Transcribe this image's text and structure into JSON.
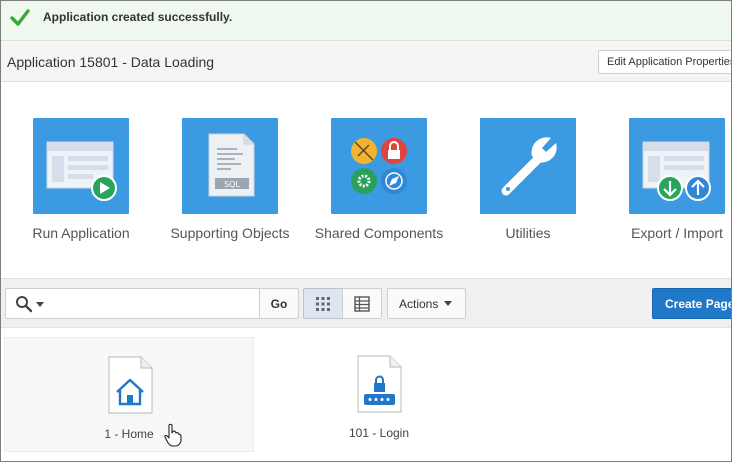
{
  "banner": {
    "message": "Application created successfully."
  },
  "header": {
    "title": "Application 15801 - Data Loading",
    "edit_button": "Edit Application Properties"
  },
  "tiles": [
    {
      "label": "Run Application",
      "icon": "run-application-icon"
    },
    {
      "label": "Supporting Objects",
      "icon": "supporting-objects-icon"
    },
    {
      "label": "Shared Components",
      "icon": "shared-components-icon"
    },
    {
      "label": "Utilities",
      "icon": "utilities-icon"
    },
    {
      "label": "Export / Import",
      "icon": "export-import-icon"
    }
  ],
  "toolbar": {
    "search_value": "",
    "go_label": "Go",
    "actions_label": "Actions",
    "create_page_label": "Create Page"
  },
  "pages": [
    {
      "label": "1 - Home",
      "icon": "home-page-icon"
    },
    {
      "label": "101 - Login",
      "icon": "login-page-icon"
    }
  ],
  "colors": {
    "tile": "#3b9ae1",
    "primary_button": "#1f78c8",
    "success": "#39a83a"
  }
}
